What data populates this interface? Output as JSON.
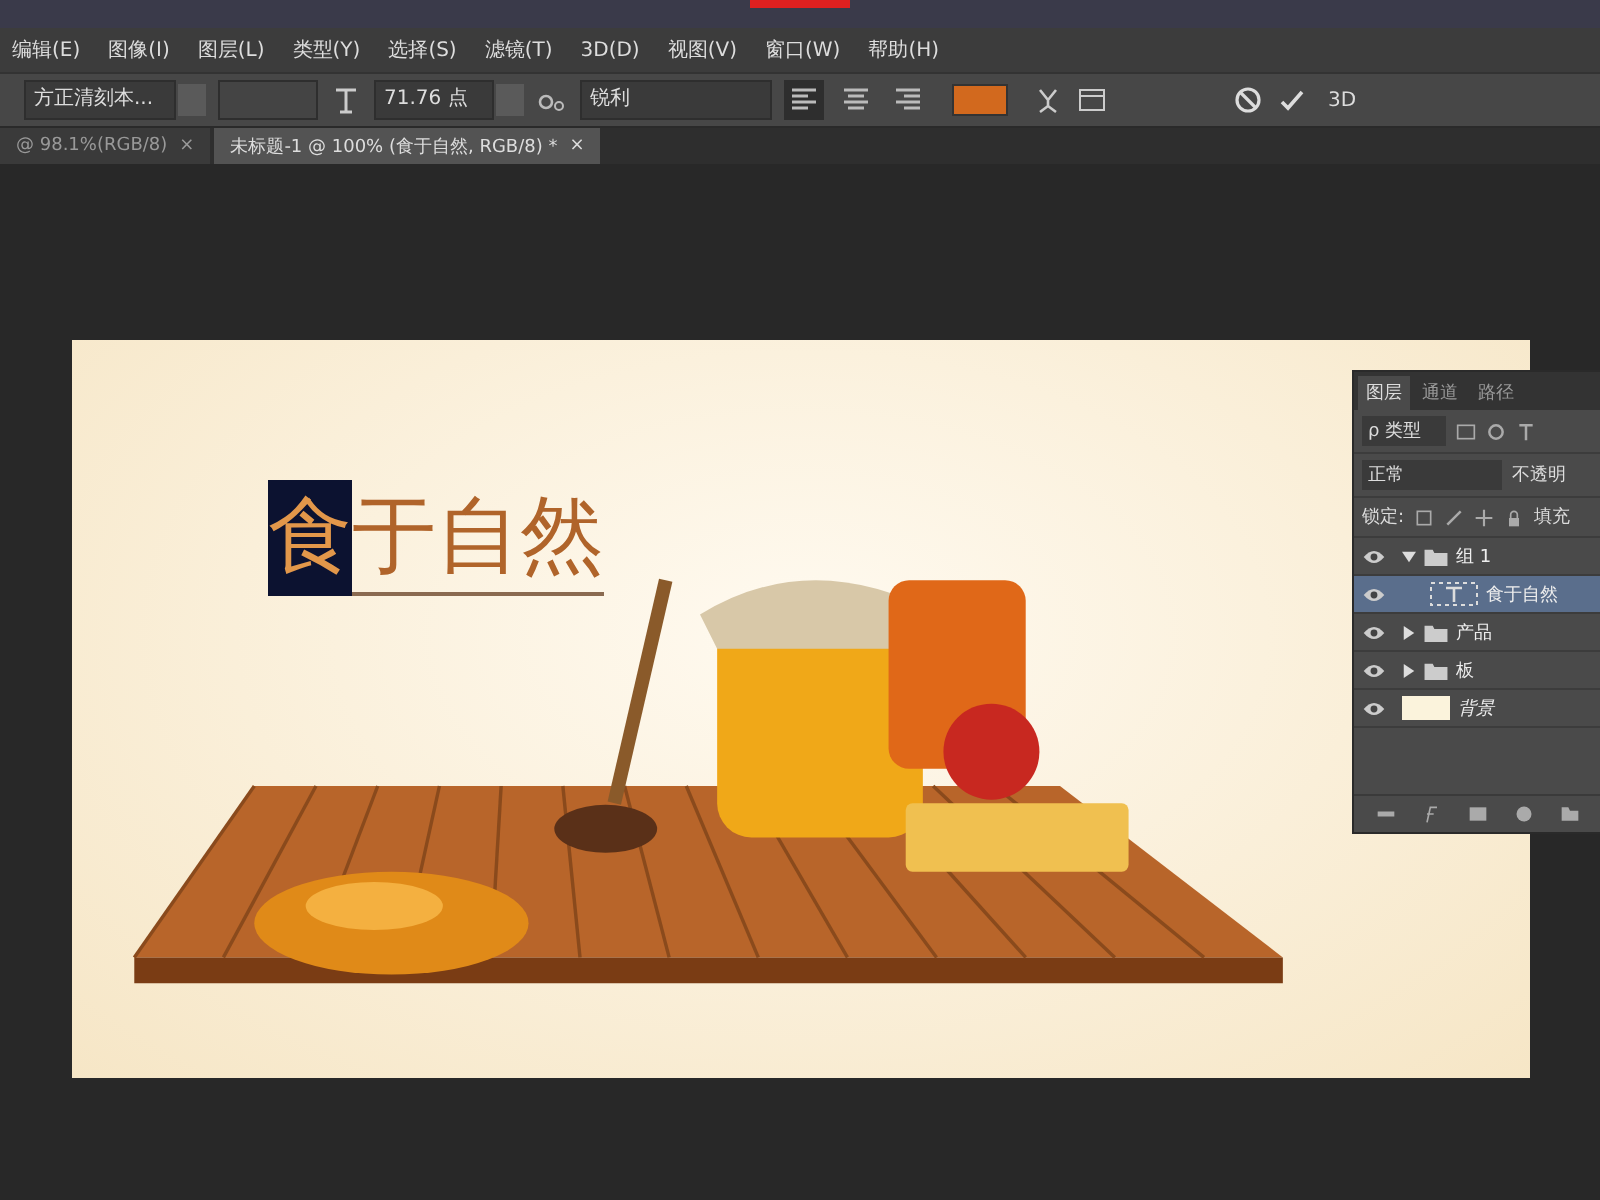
{
  "menu": [
    "编辑(E)",
    "图像(I)",
    "图层(L)",
    "类型(Y)",
    "选择(S)",
    "滤镜(T)",
    "3D(D)",
    "视图(V)",
    "窗口(W)",
    "帮助(H)"
  ],
  "options": {
    "font_family": "方正清刻本...",
    "font_size": "71.76 点",
    "antialias": "锐利",
    "align": [
      {
        "selected": true
      },
      {
        "selected": false
      },
      {
        "selected": false
      }
    ],
    "threed": "3D"
  },
  "doc_tabs": [
    {
      "label": "@ 98.1%(RGB/8)",
      "selected": false,
      "close": "×"
    },
    {
      "label": "未标题-1 @ 100% (食于自然, RGB/8) *",
      "selected": true,
      "close": "×"
    }
  ],
  "canvas": {
    "headline": {
      "selected_text": "食",
      "rest": "于自然"
    }
  },
  "layers_panel": {
    "tabs": [
      {
        "label": "图层",
        "selected": true
      },
      {
        "label": "通道",
        "selected": false
      },
      {
        "label": "路径",
        "selected": false
      }
    ],
    "filter": "ρ 类型",
    "blend_mode": "正常",
    "opacity_label": "不透明",
    "lock_label": "锁定:",
    "fill_label": "填充",
    "layers": [
      {
        "kind": "group",
        "name": "组 1",
        "expanded": true,
        "visible": true,
        "selected": false,
        "children": [
          {
            "kind": "text",
            "name": "食于自然",
            "visible": true,
            "selected": true
          }
        ]
      },
      {
        "kind": "group",
        "name": "产品",
        "expanded": false,
        "visible": true,
        "selected": false
      },
      {
        "kind": "group",
        "name": "板",
        "expanded": false,
        "visible": true,
        "selected": false
      },
      {
        "kind": "background",
        "name": "背景",
        "visible": true,
        "selected": false
      }
    ]
  }
}
